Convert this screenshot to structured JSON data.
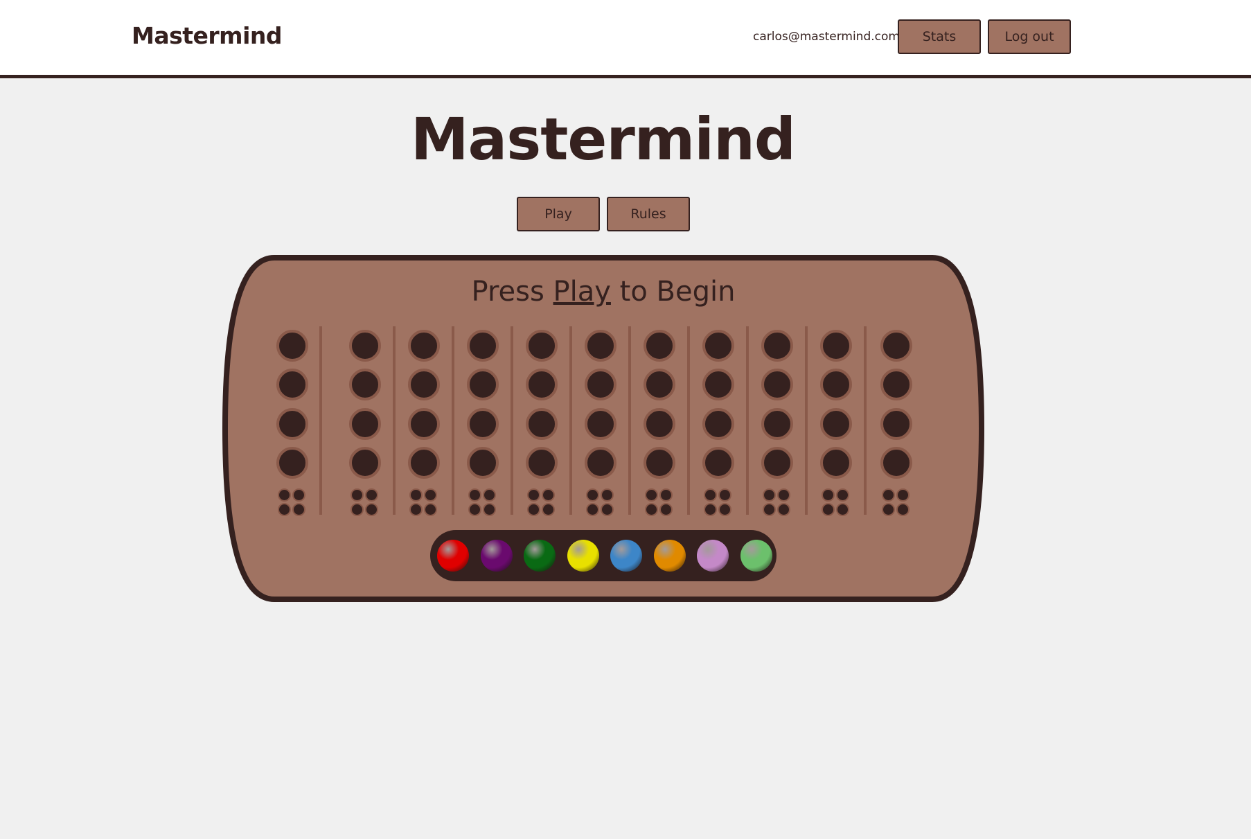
{
  "nav": {
    "brand": "Mastermind",
    "user_email": "carlos@mastermind.com",
    "stats_label": "Stats",
    "logout_label": "Log out"
  },
  "main": {
    "title": "Mastermind",
    "play_label": "Play",
    "rules_label": "Rules"
  },
  "board": {
    "prompt_before": "Press ",
    "prompt_link": "Play",
    "prompt_after": " to Begin",
    "columns": 11,
    "holes_per_column": 4,
    "feedback_pegs_per_column": 4
  },
  "colors": {
    "accent": "#a07362",
    "dark": "#35211f",
    "hole_ring": "#8a5a4a",
    "background": "#f0f0f0",
    "palette": [
      {
        "name": "red",
        "hex": "#e00000"
      },
      {
        "name": "purple",
        "hex": "#6a0a6e"
      },
      {
        "name": "green",
        "hex": "#0a6a14"
      },
      {
        "name": "yellow",
        "hex": "#e8e000"
      },
      {
        "name": "blue",
        "hex": "#3d86c8"
      },
      {
        "name": "orange",
        "hex": "#e08a00"
      },
      {
        "name": "lilac",
        "hex": "#c489c8"
      },
      {
        "name": "light-green",
        "hex": "#6cc06c"
      }
    ]
  }
}
